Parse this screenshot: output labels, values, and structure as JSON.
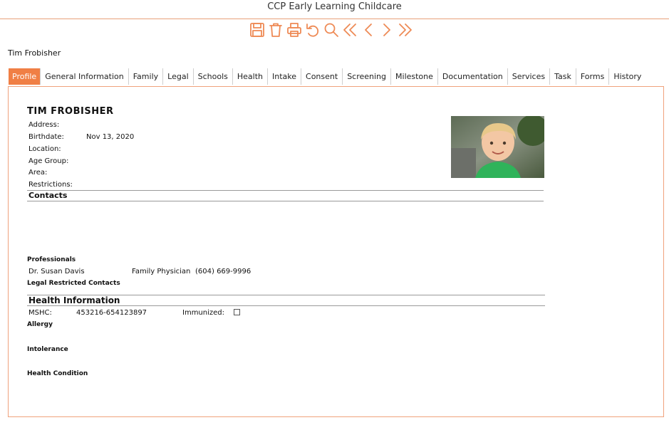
{
  "app": {
    "title": "CCP Early Learning Childcare"
  },
  "toolbar": [
    {
      "name": "save-icon"
    },
    {
      "name": "delete-icon"
    },
    {
      "name": "print-icon"
    },
    {
      "name": "undo-icon"
    },
    {
      "name": "search-icon"
    },
    {
      "name": "first-record-icon"
    },
    {
      "name": "previous-record-icon"
    },
    {
      "name": "next-record-icon"
    },
    {
      "name": "last-record-icon"
    }
  ],
  "header": {
    "child_name": "Tim Frobisher"
  },
  "tabs": [
    {
      "label": "Profile",
      "active": true
    },
    {
      "label": "General Information"
    },
    {
      "label": "Family"
    },
    {
      "label": "Legal"
    },
    {
      "label": "Schools"
    },
    {
      "label": "Health"
    },
    {
      "label": "Intake"
    },
    {
      "label": "Consent"
    },
    {
      "label": "Screening"
    },
    {
      "label": "Milestone"
    },
    {
      "label": "Documentation"
    },
    {
      "label": "Services"
    },
    {
      "label": "Task"
    },
    {
      "label": "Forms"
    },
    {
      "label": "History"
    }
  ],
  "profile": {
    "name": "TIM FROBISHER",
    "fields": {
      "address_label": "Address:",
      "birthdate_label": "Birthdate:",
      "birthdate_value": "Nov 13, 2020",
      "location_label": "Location:",
      "age_group_label": "Age Group:",
      "area_label": "Area:",
      "restrictions_label": "Restrictions:"
    }
  },
  "contacts": {
    "heading": "Contacts",
    "professionals_label": "Professionals",
    "professionals": [
      {
        "name": "Dr. Susan Davis",
        "role": "Family Physician",
        "phone": "(604) 669-9996"
      }
    ],
    "legal_restricted_label": "Legal Restricted Contacts"
  },
  "health": {
    "heading": "Health Information",
    "mshc_label": "MSHC:",
    "mshc_value": "453216-654123897",
    "immunized_label": "Immunized:",
    "immunized": false,
    "allergy_label": "Allergy",
    "intolerance_label": "Intolerance",
    "health_condition_label": "Health Condition"
  },
  "colors": {
    "accent": "#f07f45",
    "border": "#f0a27c"
  }
}
